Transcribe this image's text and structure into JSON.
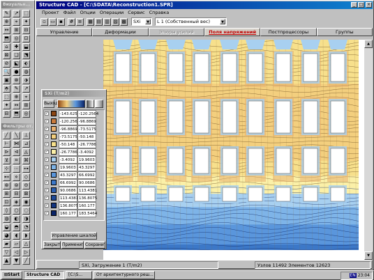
{
  "left_toolbar": {
    "title": "Визуальн...",
    "filter_title": "Фильтры от..."
  },
  "window": {
    "title": "Structure CAD - [C:\\SDATA\\Reconstruction1.SPR]",
    "buttons": [
      "_",
      "□",
      "×"
    ]
  },
  "menu": [
    "Проект",
    "Файл",
    "Опции",
    "Операции",
    "Сервис",
    "Справка"
  ],
  "toolbar": {
    "component_select": "SXi",
    "load_select": "L 1 (Собственный вес)"
  },
  "tabs": [
    "Управление",
    "Деформации",
    "Эпюры усилий",
    "Поля напряжений",
    "Постпроцессоры",
    "Группы"
  ],
  "legend": {
    "title": "SXi (T/m2)",
    "exit_label": "Выход",
    "rows": [
      {
        "min": "-143.6258",
        "max": "-120.2564",
        "color": "#8b4513"
      },
      {
        "min": "-120.2564",
        "max": "-96.8869",
        "color": "#c87a3c"
      },
      {
        "min": "-96.8869",
        "max": "-73.5175",
        "color": "#e8b070"
      },
      {
        "min": "-73.5175",
        "max": "-50.148",
        "color": "#f3cf7e"
      },
      {
        "min": "-50.148",
        "max": "-26.7786",
        "color": "#f7e08c"
      },
      {
        "min": "-26.7786",
        "max": "-3.4092",
        "color": "#fbf0a8"
      },
      {
        "min": "-3.4092",
        "max": "19.9603",
        "color": "#a8d0f0"
      },
      {
        "min": "19.9603",
        "max": "43.3297",
        "color": "#7eb4e8"
      },
      {
        "min": "43.3297",
        "max": "66.6992",
        "color": "#5a96dc"
      },
      {
        "min": "66.6992",
        "max": "90.0686",
        "color": "#3c78c8"
      },
      {
        "min": "90.0686",
        "max": "113.4381",
        "color": "#2a5eb0"
      },
      {
        "min": "113.4381",
        "max": "136.8075",
        "color": "#1c4898"
      },
      {
        "min": "136.8075",
        "max": "160.177",
        "color": "#123480"
      },
      {
        "min": "160.177",
        "max": "183.5464",
        "color": "#0a2468"
      }
    ],
    "manage_scale_label": "Управление шкалой",
    "close_label": "Закрыть",
    "apply_label": "Применить",
    "save_label": "Сохранить"
  },
  "status": {
    "panel1": "SXi, Загружение 1 (T/m2)",
    "panel2": "Узлов 11492 Элементов 12623"
  },
  "taskbar": {
    "start_label": "Start",
    "tasks": [
      "Structure CAD",
      "[C:\\S...",
      "От архитектурного реш..."
    ],
    "lang": "EN",
    "clock": "23:04"
  }
}
